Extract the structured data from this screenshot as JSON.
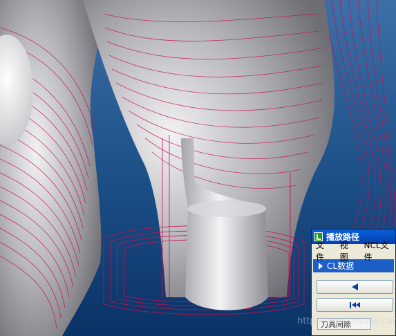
{
  "panel": {
    "title": "播放路径",
    "menu": [
      "文件",
      "视图",
      "NCL文件"
    ],
    "section_label": "CL数据",
    "step_back_icon": "triangle-left-icon",
    "rewind_icon": "rewind-to-start-icon",
    "tool_gap_label": "刀具间隙"
  },
  "watermark": "http://www.jinfuoe.com",
  "colors": {
    "toolpath": "#c8104e",
    "background": "#0e3f72",
    "panel_title": "#0a4fd0"
  }
}
